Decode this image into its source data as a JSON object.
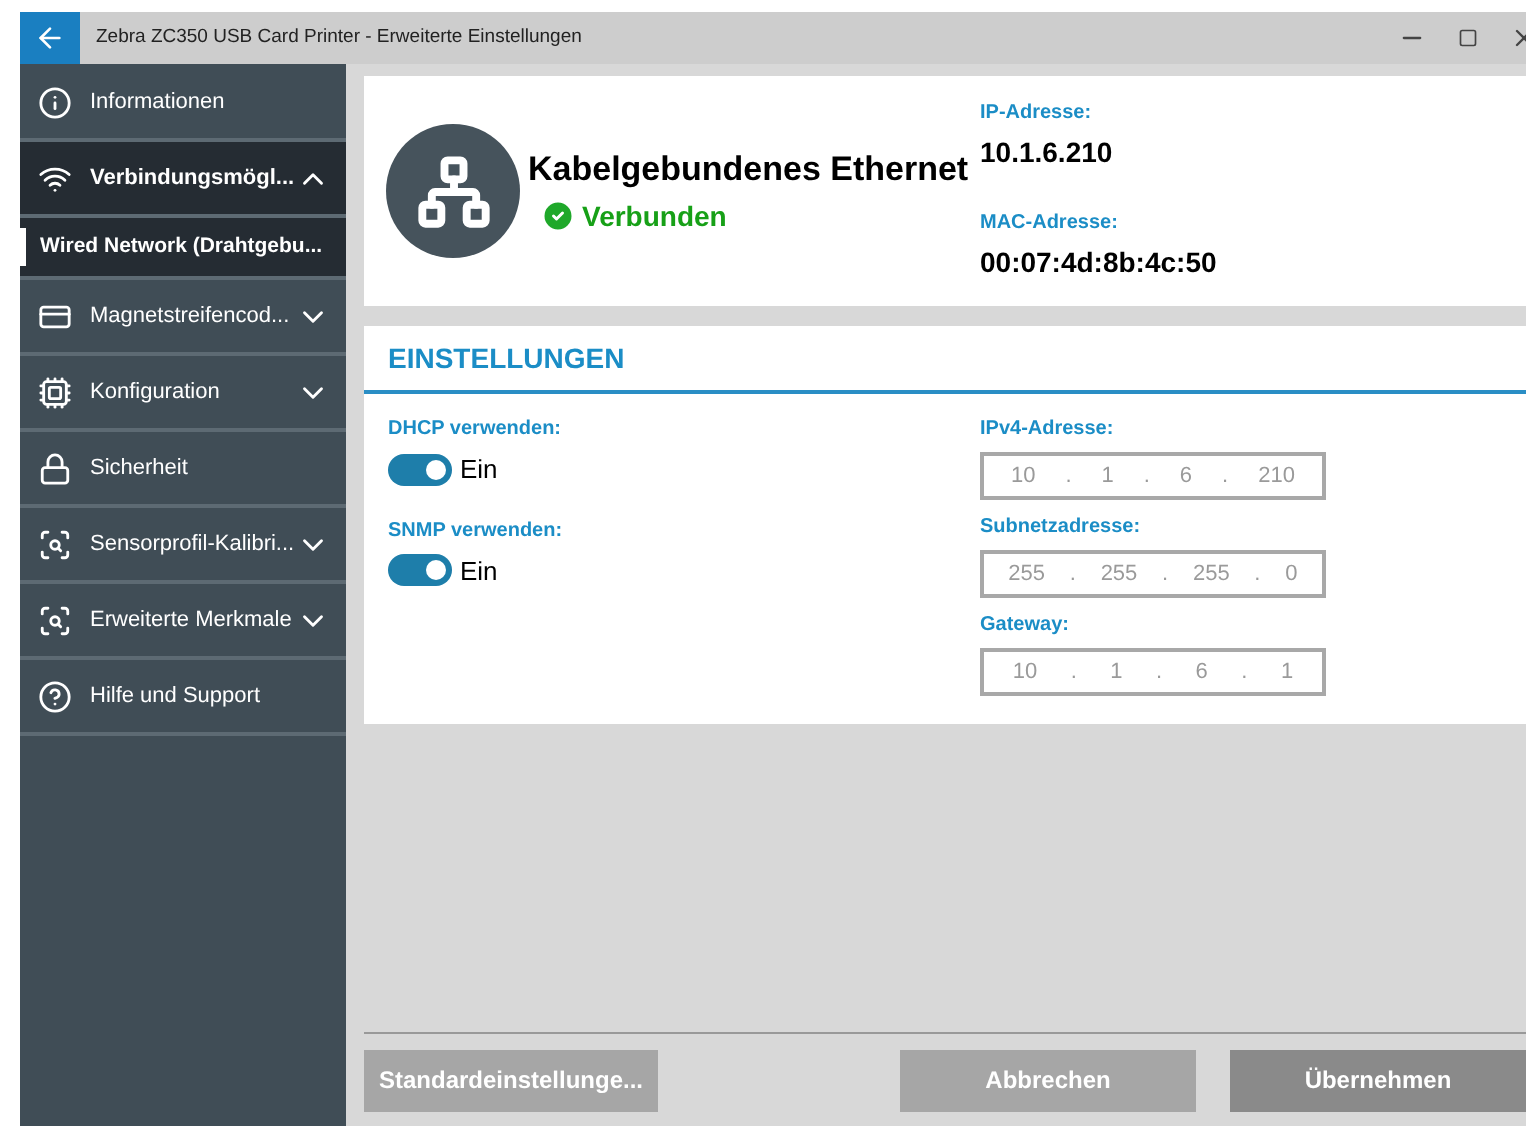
{
  "window": {
    "title": "Zebra ZC350 USB Card Printer - Erweiterte Einstellungen"
  },
  "sidebar": {
    "items": [
      {
        "label": "Informationen",
        "kind": "item",
        "selected": false
      },
      {
        "label": "Verbindungsmögl...",
        "kind": "group",
        "selected": false,
        "expanded": true
      },
      {
        "label": "Wired Network (Drahtgebu...",
        "kind": "subitem",
        "selected": true
      },
      {
        "label": "Magnetstreifencod...",
        "kind": "group",
        "selected": false,
        "expanded": false
      },
      {
        "label": "Konfiguration",
        "kind": "group",
        "selected": false,
        "expanded": false
      },
      {
        "label": "Sicherheit",
        "kind": "item",
        "selected": false
      },
      {
        "label": "Sensorprofil-Kalibri...",
        "kind": "group",
        "selected": false,
        "expanded": false
      },
      {
        "label": "Erweiterte Merkmale",
        "kind": "group",
        "selected": false,
        "expanded": false
      },
      {
        "label": "Hilfe und Support",
        "kind": "item",
        "selected": false
      }
    ]
  },
  "connection": {
    "title": "Kabelgebundenes Ethernet",
    "status": "Verbunden",
    "connected": true,
    "details": [
      {
        "label": "IP-Adresse:",
        "value": "10.1.6.210"
      },
      {
        "label": "MAC-Adresse:",
        "value": "00:07:4d:8b:4c:50"
      }
    ]
  },
  "settings": {
    "title": "EINSTELLUNGEN",
    "toggles": [
      {
        "label": "DHCP verwenden:",
        "on": true,
        "state_text": "Ein"
      },
      {
        "label": "SNMP verwenden:",
        "on": true,
        "state_text": "Ein"
      }
    ],
    "addresses": [
      {
        "label": "IPv4-Adresse:",
        "octets": [
          "10",
          "1",
          "6",
          "210"
        ],
        "separators": [
          ".",
          ".",
          "."
        ]
      },
      {
        "label": "Subnetzadresse:",
        "octets": [
          "255",
          "255",
          "255",
          "0"
        ],
        "separators": [
          ".",
          ".",
          "."
        ]
      },
      {
        "label": "Gateway:",
        "octets": [
          "10",
          "1",
          "6",
          "1"
        ],
        "separators": [
          ".",
          ".",
          "."
        ]
      }
    ]
  },
  "buttons": [
    {
      "label": "Standardeinstellunge...",
      "kind": "secondary"
    },
    {
      "label": "Abbrechen",
      "kind": "secondary"
    },
    {
      "label": "Übernehmen",
      "kind": "primary"
    }
  ]
}
